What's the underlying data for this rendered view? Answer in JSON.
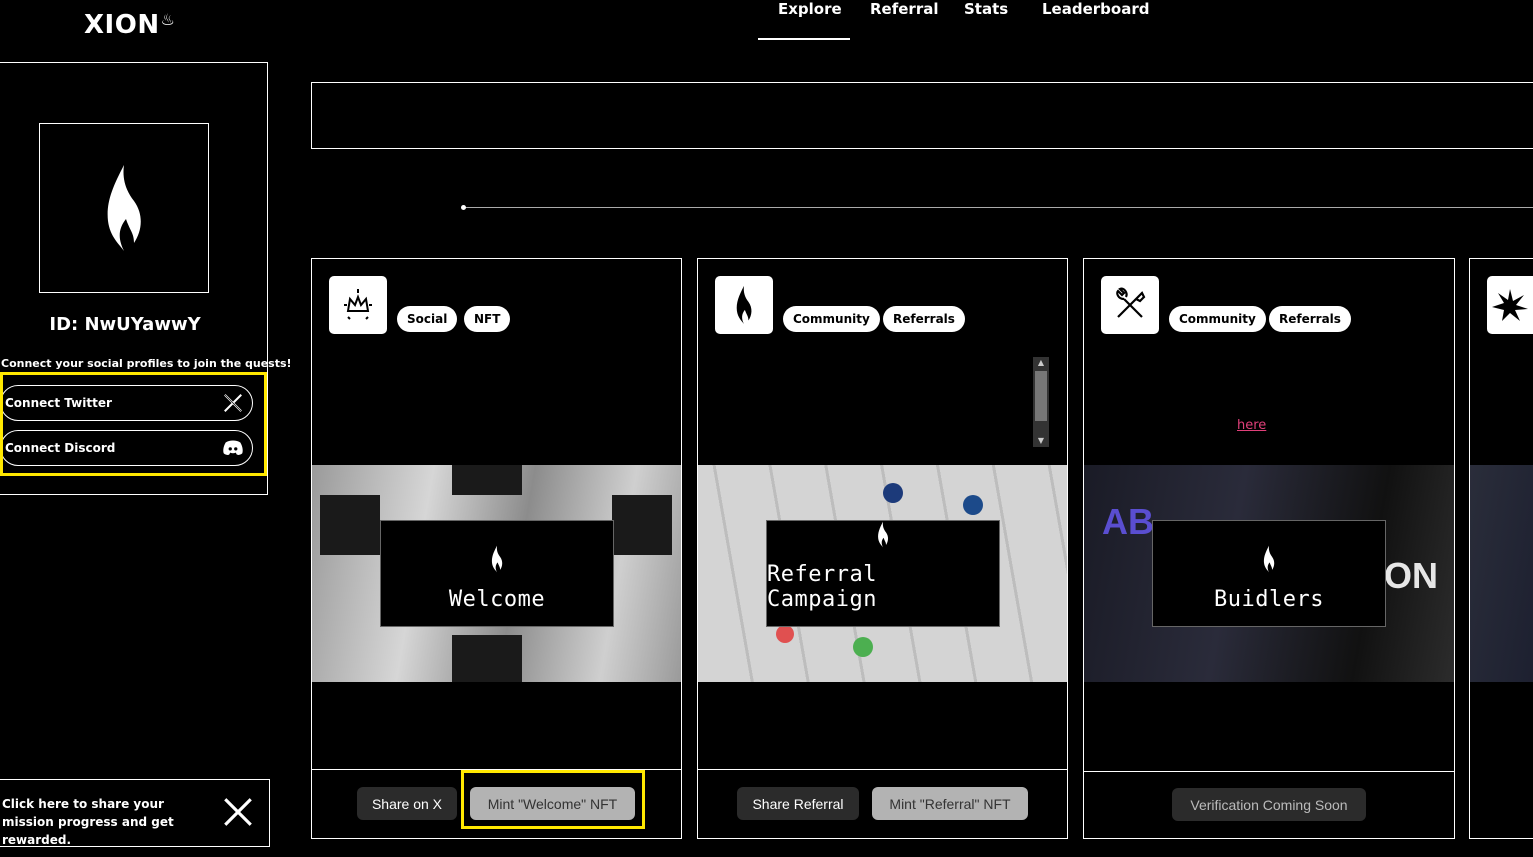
{
  "header": {
    "logo": "XION",
    "tabs": [
      "Explore",
      "Referral",
      "Stats",
      "Leaderboard"
    ],
    "active_tab": "Explore"
  },
  "sidebar": {
    "user_id": "ID: NwUYawwY",
    "connect_message": "Connect your social profiles to join the quests!",
    "connect_twitter": "Connect Twitter",
    "connect_discord": "Connect Discord",
    "share_prompt": "Click here to share your mission progress and get rewarded."
  },
  "cards": [
    {
      "tags": [
        "Social",
        "NFT"
      ],
      "title": "Welcome",
      "buttons": [
        "Share on X",
        "Mint \"Welcome\" NFT"
      ]
    },
    {
      "tags": [
        "Community",
        "Referrals"
      ],
      "title": "Referral Campaign",
      "buttons": [
        "Share Referral",
        "Mint \"Referral\" NFT"
      ]
    },
    {
      "tags": [
        "Community",
        "Referrals"
      ],
      "title": "Buidlers",
      "link": "here",
      "buttons": [
        "Verification Coming Soon"
      ]
    }
  ],
  "colors": {
    "background": "#000000",
    "highlight": "#ffe800",
    "link": "#e0407a"
  }
}
